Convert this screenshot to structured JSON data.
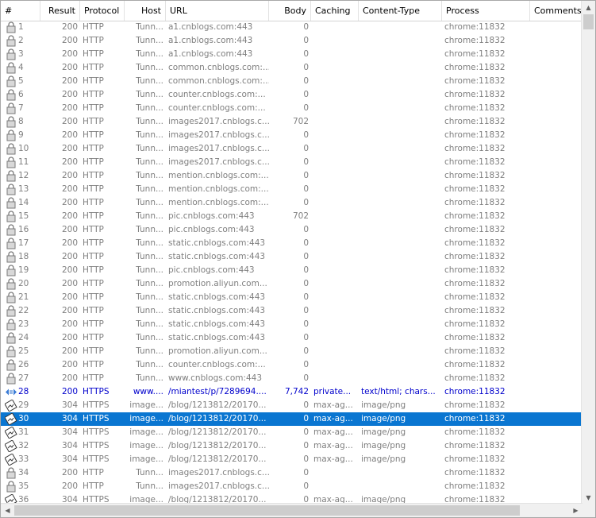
{
  "columns": [
    "#",
    "Result",
    "Protocol",
    "Host",
    "URL",
    "Body",
    "Caching",
    "Content-Type",
    "Process",
    "Comments"
  ],
  "rows": [
    {
      "n": "1",
      "result": "200",
      "protocol": "HTTP",
      "host": "Tunn...",
      "url": "a1.cnblogs.com:443",
      "body": "0",
      "caching": "",
      "ctype": "",
      "process": "chrome:11832",
      "icon": "lock"
    },
    {
      "n": "2",
      "result": "200",
      "protocol": "HTTP",
      "host": "Tunn...",
      "url": "a1.cnblogs.com:443",
      "body": "0",
      "caching": "",
      "ctype": "",
      "process": "chrome:11832",
      "icon": "lock"
    },
    {
      "n": "3",
      "result": "200",
      "protocol": "HTTP",
      "host": "Tunn...",
      "url": "a1.cnblogs.com:443",
      "body": "0",
      "caching": "",
      "ctype": "",
      "process": "chrome:11832",
      "icon": "lock"
    },
    {
      "n": "4",
      "result": "200",
      "protocol": "HTTP",
      "host": "Tunn...",
      "url": "common.cnblogs.com:...",
      "body": "0",
      "caching": "",
      "ctype": "",
      "process": "chrome:11832",
      "icon": "lock"
    },
    {
      "n": "5",
      "result": "200",
      "protocol": "HTTP",
      "host": "Tunn...",
      "url": "common.cnblogs.com:...",
      "body": "0",
      "caching": "",
      "ctype": "",
      "process": "chrome:11832",
      "icon": "lock"
    },
    {
      "n": "6",
      "result": "200",
      "protocol": "HTTP",
      "host": "Tunn...",
      "url": "counter.cnblogs.com:...",
      "body": "0",
      "caching": "",
      "ctype": "",
      "process": "chrome:11832",
      "icon": "lock"
    },
    {
      "n": "7",
      "result": "200",
      "protocol": "HTTP",
      "host": "Tunn...",
      "url": "counter.cnblogs.com:...",
      "body": "0",
      "caching": "",
      "ctype": "",
      "process": "chrome:11832",
      "icon": "lock"
    },
    {
      "n": "8",
      "result": "200",
      "protocol": "HTTP",
      "host": "Tunn...",
      "url": "images2017.cnblogs.c...",
      "body": "702",
      "caching": "",
      "ctype": "",
      "process": "chrome:11832",
      "icon": "lock"
    },
    {
      "n": "9",
      "result": "200",
      "protocol": "HTTP",
      "host": "Tunn...",
      "url": "images2017.cnblogs.c...",
      "body": "0",
      "caching": "",
      "ctype": "",
      "process": "chrome:11832",
      "icon": "lock"
    },
    {
      "n": "10",
      "result": "200",
      "protocol": "HTTP",
      "host": "Tunn...",
      "url": "images2017.cnblogs.c...",
      "body": "0",
      "caching": "",
      "ctype": "",
      "process": "chrome:11832",
      "icon": "lock"
    },
    {
      "n": "11",
      "result": "200",
      "protocol": "HTTP",
      "host": "Tunn...",
      "url": "images2017.cnblogs.c...",
      "body": "0",
      "caching": "",
      "ctype": "",
      "process": "chrome:11832",
      "icon": "lock"
    },
    {
      "n": "12",
      "result": "200",
      "protocol": "HTTP",
      "host": "Tunn...",
      "url": "mention.cnblogs.com:...",
      "body": "0",
      "caching": "",
      "ctype": "",
      "process": "chrome:11832",
      "icon": "lock"
    },
    {
      "n": "13",
      "result": "200",
      "protocol": "HTTP",
      "host": "Tunn...",
      "url": "mention.cnblogs.com:...",
      "body": "0",
      "caching": "",
      "ctype": "",
      "process": "chrome:11832",
      "icon": "lock"
    },
    {
      "n": "14",
      "result": "200",
      "protocol": "HTTP",
      "host": "Tunn...",
      "url": "mention.cnblogs.com:...",
      "body": "0",
      "caching": "",
      "ctype": "",
      "process": "chrome:11832",
      "icon": "lock"
    },
    {
      "n": "15",
      "result": "200",
      "protocol": "HTTP",
      "host": "Tunn...",
      "url": "pic.cnblogs.com:443",
      "body": "702",
      "caching": "",
      "ctype": "",
      "process": "chrome:11832",
      "icon": "lock"
    },
    {
      "n": "16",
      "result": "200",
      "protocol": "HTTP",
      "host": "Tunn...",
      "url": "pic.cnblogs.com:443",
      "body": "0",
      "caching": "",
      "ctype": "",
      "process": "chrome:11832",
      "icon": "lock"
    },
    {
      "n": "17",
      "result": "200",
      "protocol": "HTTP",
      "host": "Tunn...",
      "url": "static.cnblogs.com:443",
      "body": "0",
      "caching": "",
      "ctype": "",
      "process": "chrome:11832",
      "icon": "lock"
    },
    {
      "n": "18",
      "result": "200",
      "protocol": "HTTP",
      "host": "Tunn...",
      "url": "static.cnblogs.com:443",
      "body": "0",
      "caching": "",
      "ctype": "",
      "process": "chrome:11832",
      "icon": "lock"
    },
    {
      "n": "19",
      "result": "200",
      "protocol": "HTTP",
      "host": "Tunn...",
      "url": "pic.cnblogs.com:443",
      "body": "0",
      "caching": "",
      "ctype": "",
      "process": "chrome:11832",
      "icon": "lock"
    },
    {
      "n": "20",
      "result": "200",
      "protocol": "HTTP",
      "host": "Tunn...",
      "url": "promotion.aliyun.com...",
      "body": "0",
      "caching": "",
      "ctype": "",
      "process": "chrome:11832",
      "icon": "lock"
    },
    {
      "n": "21",
      "result": "200",
      "protocol": "HTTP",
      "host": "Tunn...",
      "url": "static.cnblogs.com:443",
      "body": "0",
      "caching": "",
      "ctype": "",
      "process": "chrome:11832",
      "icon": "lock"
    },
    {
      "n": "22",
      "result": "200",
      "protocol": "HTTP",
      "host": "Tunn...",
      "url": "static.cnblogs.com:443",
      "body": "0",
      "caching": "",
      "ctype": "",
      "process": "chrome:11832",
      "icon": "lock"
    },
    {
      "n": "23",
      "result": "200",
      "protocol": "HTTP",
      "host": "Tunn...",
      "url": "static.cnblogs.com:443",
      "body": "0",
      "caching": "",
      "ctype": "",
      "process": "chrome:11832",
      "icon": "lock"
    },
    {
      "n": "24",
      "result": "200",
      "protocol": "HTTP",
      "host": "Tunn...",
      "url": "static.cnblogs.com:443",
      "body": "0",
      "caching": "",
      "ctype": "",
      "process": "chrome:11832",
      "icon": "lock"
    },
    {
      "n": "25",
      "result": "200",
      "protocol": "HTTP",
      "host": "Tunn...",
      "url": "promotion.aliyun.com...",
      "body": "0",
      "caching": "",
      "ctype": "",
      "process": "chrome:11832",
      "icon": "lock"
    },
    {
      "n": "26",
      "result": "200",
      "protocol": "HTTP",
      "host": "Tunn...",
      "url": "counter.cnblogs.com:...",
      "body": "0",
      "caching": "",
      "ctype": "",
      "process": "chrome:11832",
      "icon": "lock"
    },
    {
      "n": "27",
      "result": "200",
      "protocol": "HTTP",
      "host": "Tunn...",
      "url": "www.cnblogs.com:443",
      "body": "0",
      "caching": "",
      "ctype": "",
      "process": "chrome:11832",
      "icon": "lock"
    },
    {
      "n": "28",
      "result": "200",
      "protocol": "HTTPS",
      "host": "www....",
      "url": "/miantest/p/7289694....",
      "body": "7,742",
      "caching": "private...",
      "ctype": "text/html; chars...",
      "process": "chrome:11832",
      "icon": "html",
      "highlight": true
    },
    {
      "n": "29",
      "result": "304",
      "protocol": "HTTPS",
      "host": "image...",
      "url": "/blog/1213812/20170...",
      "body": "0",
      "caching": "max-ag...",
      "ctype": "image/png",
      "process": "chrome:11832",
      "icon": "image"
    },
    {
      "n": "30",
      "result": "304",
      "protocol": "HTTPS",
      "host": "image...",
      "url": "/blog/1213812/20170...",
      "body": "0",
      "caching": "max-ag...",
      "ctype": "image/png",
      "process": "chrome:11832",
      "icon": "image",
      "selected": true
    },
    {
      "n": "31",
      "result": "304",
      "protocol": "HTTPS",
      "host": "image...",
      "url": "/blog/1213812/20170...",
      "body": "0",
      "caching": "max-ag...",
      "ctype": "image/png",
      "process": "chrome:11832",
      "icon": "image"
    },
    {
      "n": "32",
      "result": "304",
      "protocol": "HTTPS",
      "host": "image...",
      "url": "/blog/1213812/20170...",
      "body": "0",
      "caching": "max-ag...",
      "ctype": "image/png",
      "process": "chrome:11832",
      "icon": "image"
    },
    {
      "n": "33",
      "result": "304",
      "protocol": "HTTPS",
      "host": "image...",
      "url": "/blog/1213812/20170...",
      "body": "0",
      "caching": "max-ag...",
      "ctype": "image/png",
      "process": "chrome:11832",
      "icon": "image"
    },
    {
      "n": "34",
      "result": "200",
      "protocol": "HTTP",
      "host": "Tunn...",
      "url": "images2017.cnblogs.c...",
      "body": "0",
      "caching": "",
      "ctype": "",
      "process": "chrome:11832",
      "icon": "lock"
    },
    {
      "n": "35",
      "result": "200",
      "protocol": "HTTP",
      "host": "Tunn...",
      "url": "images2017.cnblogs.c...",
      "body": "0",
      "caching": "",
      "ctype": "",
      "process": "chrome:11832",
      "icon": "lock"
    },
    {
      "n": "36",
      "result": "304",
      "protocol": "HTTPS",
      "host": "image...",
      "url": "/blog/1213812/20170...",
      "body": "0",
      "caching": "max-ag...",
      "ctype": "image/png",
      "process": "chrome:11832",
      "icon": "image"
    }
  ],
  "colors": {
    "selected": "#0a76d1",
    "highlight": "#0000cc",
    "text": "#7f7f7f"
  }
}
